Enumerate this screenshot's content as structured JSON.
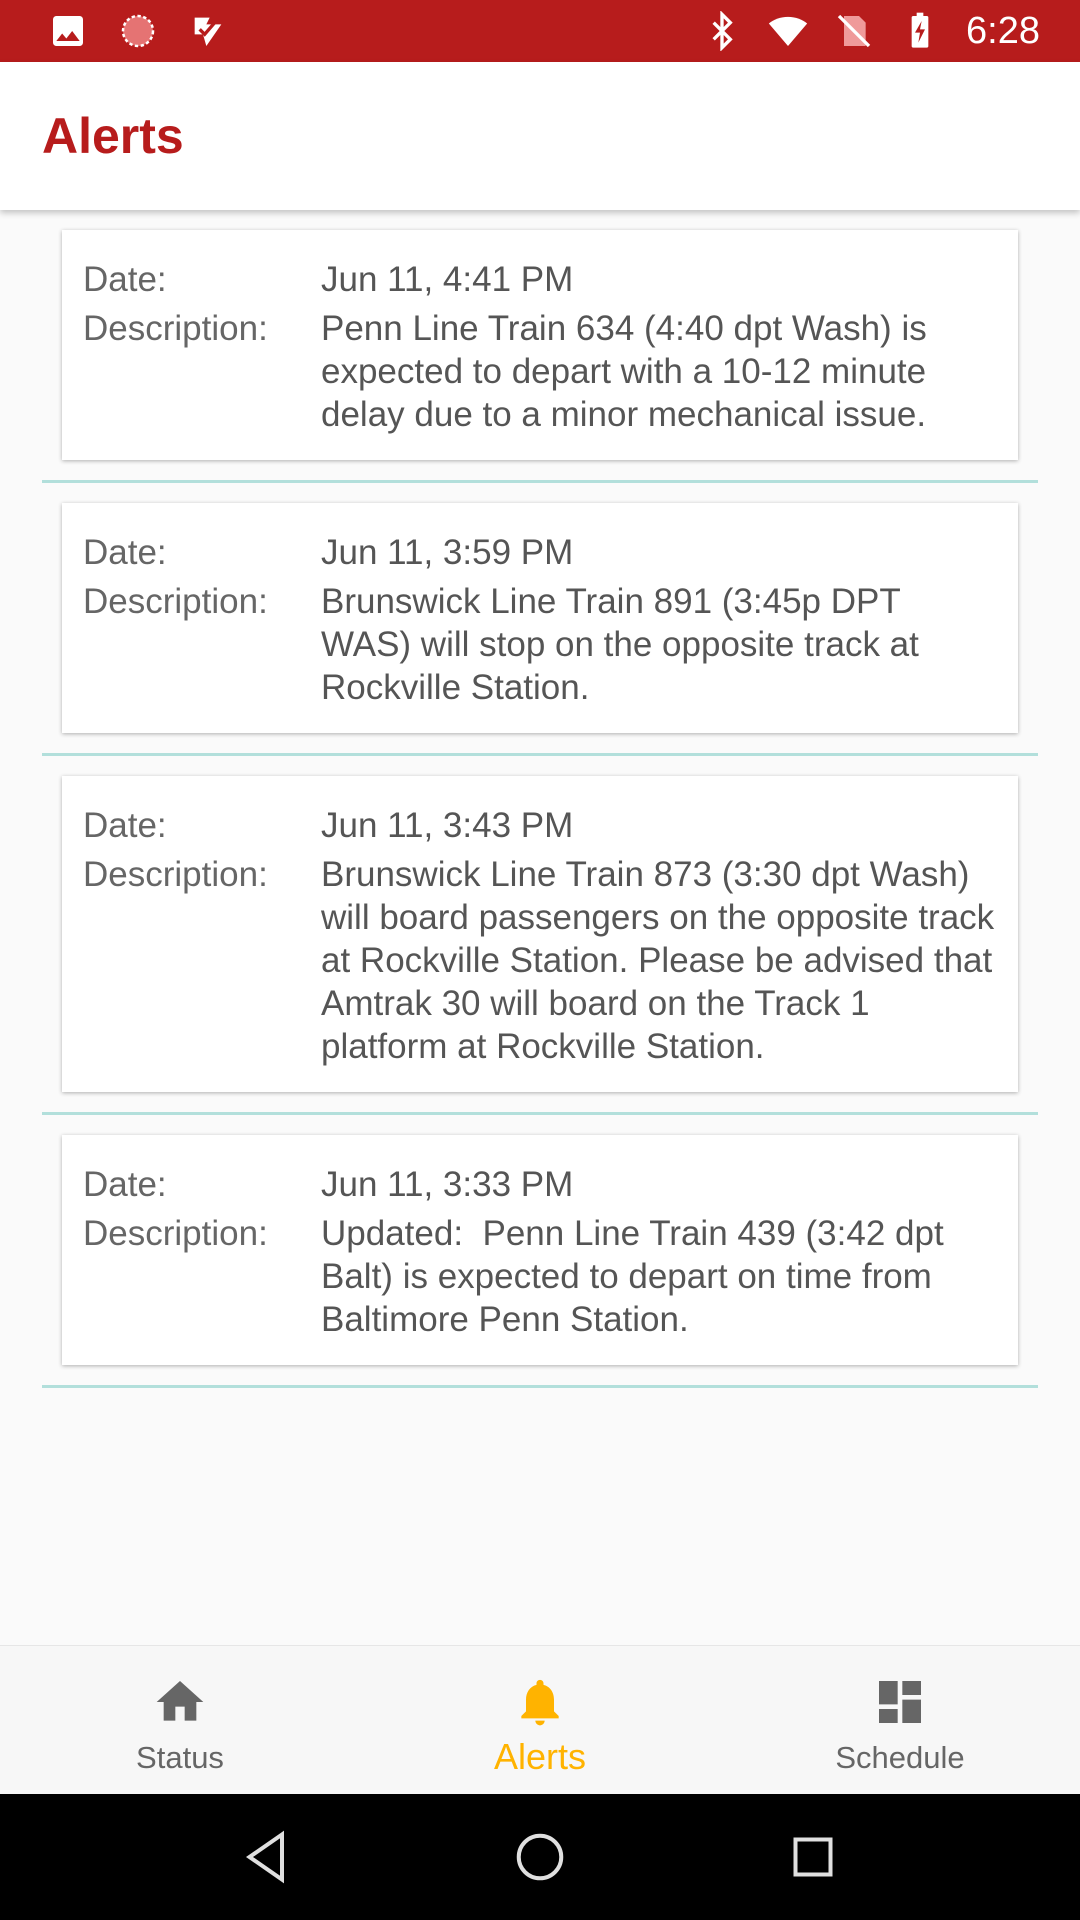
{
  "status_bar": {
    "time": "6:28",
    "left_icons": [
      "image-icon",
      "spinner-icon",
      "check-flag-icon"
    ],
    "right_icons": [
      "bluetooth-icon",
      "wifi-icon",
      "no-sim-icon",
      "battery-charging-icon"
    ],
    "background_color": "#b71c1c"
  },
  "app_bar": {
    "title": "Alerts",
    "title_color": "#b71c1c"
  },
  "alerts": [
    {
      "date_label": "Date:",
      "date": "Jun 11, 4:41 PM",
      "description_label": "Description:",
      "description": "Penn Line Train 634 (4:40 dpt Wash) is expected to depart with a 10-12 minute delay due to a minor mechanical issue."
    },
    {
      "date_label": "Date:",
      "date": "Jun 11, 3:59 PM",
      "description_label": "Description:",
      "description": "Brunswick Line Train 891 (3:45p DPT WAS) will stop on the opposite track at Rockville Station."
    },
    {
      "date_label": "Date:",
      "date": "Jun 11, 3:43 PM",
      "description_label": "Description:",
      "description": "Brunswick Line Train 873 (3:30 dpt Wash) will board passengers on the opposite track at Rockville Station. Please be advised that Amtrak 30 will board on the Track 1 platform at Rockville Station."
    },
    {
      "date_label": "Date:",
      "date": "Jun 11, 3:33 PM",
      "description_label": "Description:",
      "description": "Updated:  Penn Line Train 439 (3:42 dpt Balt) is expected to depart on time from Baltimore Penn Station."
    }
  ],
  "bottom_nav": {
    "items": [
      {
        "label": "Status",
        "icon": "home-icon",
        "active": false
      },
      {
        "label": "Alerts",
        "icon": "bell-icon",
        "active": true
      },
      {
        "label": "Schedule",
        "icon": "dashboard-icon",
        "active": false
      }
    ],
    "active_color": "#ffb300",
    "inactive_color": "#666666"
  },
  "system_nav": {
    "buttons": [
      "back-icon",
      "home-circle-icon",
      "recents-icon"
    ]
  },
  "colors": {
    "divider": "#b2dfdb",
    "background": "#fafafa"
  }
}
